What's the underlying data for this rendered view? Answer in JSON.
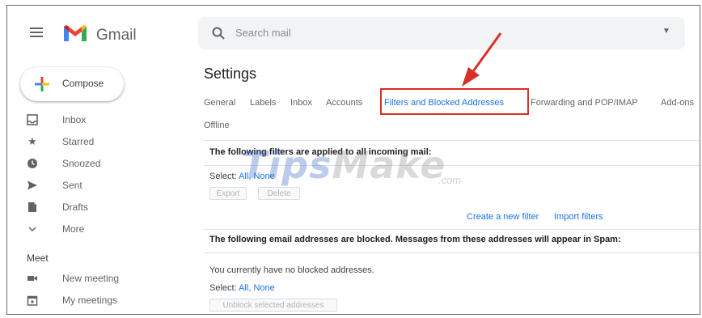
{
  "header": {
    "brand": "Gmail",
    "search_placeholder": "Search mail"
  },
  "sidebar": {
    "compose_label": "Compose",
    "items": [
      {
        "label": "Inbox",
        "icon": "inbox-icon"
      },
      {
        "label": "Starred",
        "icon": "star-icon"
      },
      {
        "label": "Snoozed",
        "icon": "clock-icon"
      },
      {
        "label": "Sent",
        "icon": "send-icon"
      },
      {
        "label": "Drafts",
        "icon": "draft-icon"
      },
      {
        "label": "More",
        "icon": "chevron-down-icon"
      }
    ],
    "meet": {
      "heading": "Meet",
      "items": [
        {
          "label": "New meeting",
          "icon": "video-icon"
        },
        {
          "label": "My meetings",
          "icon": "calendar-icon"
        }
      ]
    }
  },
  "main": {
    "title": "Settings",
    "tabs": [
      {
        "label": "General"
      },
      {
        "label": "Labels"
      },
      {
        "label": "Inbox"
      },
      {
        "label": "Accounts"
      },
      {
        "label": "Filters and Blocked Addresses"
      },
      {
        "label": "Forwarding and POP/IMAP"
      },
      {
        "label": "Add-ons"
      },
      {
        "label": "Offline"
      }
    ],
    "active_tab": "Filters and Blocked Addresses",
    "filters": {
      "heading": "The following filters are applied to all incoming mail:",
      "select_label": "Select:",
      "select_all": "All",
      "select_sep": ",",
      "select_none": "None",
      "export_label": "Export",
      "delete_label": "Delete",
      "create_filter": "Create a new filter",
      "import_filters": "Import filters"
    },
    "blocked": {
      "heading": "The following email addresses are blocked. Messages from these addresses will appear in Spam:",
      "empty_text": "You currently have no blocked addresses.",
      "select_label": "Select:",
      "select_all": "All",
      "select_sep": ",",
      "select_none": "None",
      "unblock_label": "Unblock selected addresses"
    }
  },
  "watermark": {
    "first": "Tips",
    "rest": "Make",
    "suffix": ".com"
  },
  "colors": {
    "accent": "#1a73e8",
    "highlight": "#d93025",
    "gmail_red": "#ea4335",
    "gmail_blue": "#4285f4",
    "gmail_green": "#34a853",
    "gmail_yellow": "#fbbc04"
  }
}
